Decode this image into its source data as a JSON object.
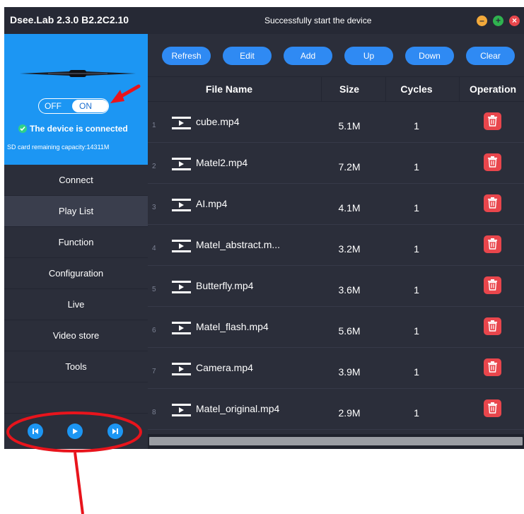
{
  "window": {
    "title": "Dsee.Lab 2.3.0 B2.2C2.10",
    "status_message": "Successfully start the device"
  },
  "device": {
    "toggle_off_label": "OFF",
    "toggle_on_label": "ON",
    "toggle_state": "on",
    "connection_status": "The device is connected",
    "sd_capacity": "SD card remaining capacity:14311M"
  },
  "nav": {
    "items": [
      "Connect",
      "Play List",
      "Function",
      "Configuration",
      "Live",
      "Video store",
      "Tools"
    ],
    "active": "Play List"
  },
  "toolbar": {
    "buttons": [
      "Refresh",
      "Edit",
      "Add",
      "Up",
      "Down",
      "Clear"
    ]
  },
  "table": {
    "columns": [
      "File Name",
      "Size",
      "Cycles",
      "Operation"
    ],
    "rows": [
      {
        "num": "1",
        "name": "cube.mp4",
        "size": "5.1M",
        "cycles": "1"
      },
      {
        "num": "2",
        "name": "Matel2.mp4",
        "size": "7.2M",
        "cycles": "1"
      },
      {
        "num": "3",
        "name": "AI.mp4",
        "size": "4.1M",
        "cycles": "1"
      },
      {
        "num": "4",
        "name": "Matel_abstract.m...",
        "size": "3.2M",
        "cycles": "1"
      },
      {
        "num": "5",
        "name": "Butterfly.mp4",
        "size": "3.6M",
        "cycles": "1"
      },
      {
        "num": "6",
        "name": "Matel_flash.mp4",
        "size": "5.6M",
        "cycles": "1"
      },
      {
        "num": "7",
        "name": "Camera.mp4",
        "size": "3.9M",
        "cycles": "1"
      },
      {
        "num": "8",
        "name": "Matel_original.mp4",
        "size": "2.9M",
        "cycles": "1"
      }
    ]
  },
  "icons": {
    "window_controls": [
      "minimize-icon",
      "maximize-icon",
      "close-icon"
    ],
    "player": [
      "previous-icon",
      "play-icon",
      "next-icon"
    ],
    "row": [
      "video-file-icon",
      "trash-icon"
    ],
    "status": "check-circle-icon"
  },
  "colors": {
    "accent_blue": "#1c96f3",
    "button_blue": "#2f8af3",
    "delete_red": "#e9464c",
    "connected_green": "#2fd18a",
    "annotation_red": "#e8141c",
    "background": "#2b2e3a"
  }
}
